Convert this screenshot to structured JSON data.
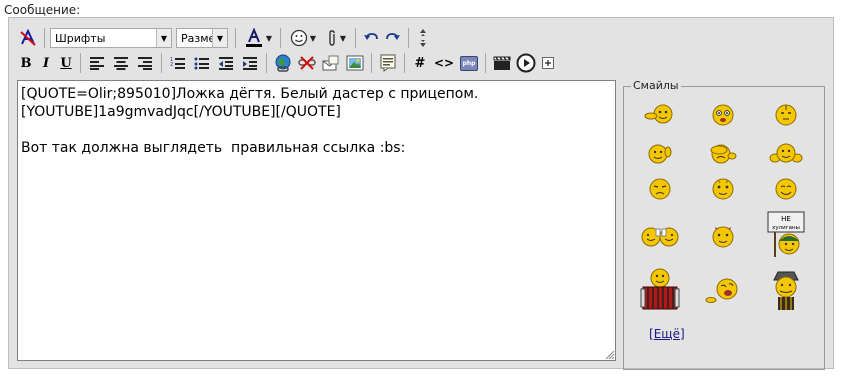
{
  "form": {
    "message_label": "Сообщение:"
  },
  "toolbar": {
    "font_select": "Шрифты",
    "size_select": "Разме",
    "bold": "B",
    "italic": "I",
    "underline": "U",
    "hash": "#",
    "code": "<>",
    "php": "php"
  },
  "editor": {
    "text": "[QUOTE=Olir;895010]Ложка дёгтя. Белый дастер с прицепом.\n[YOUTUBE]1a9gmvadJqc[/YOUTUBE][/QUOTE]\n\nВот так должна выглядеть  правильная ссылка :bs:"
  },
  "smilies": {
    "title": "Смайлы",
    "more_link": "Ещё",
    "sign_text_top": "НЕ",
    "sign_text_bottom": "хулиганы",
    "accent_color": "#f5c700",
    "outline_color": "#8a6a00"
  }
}
